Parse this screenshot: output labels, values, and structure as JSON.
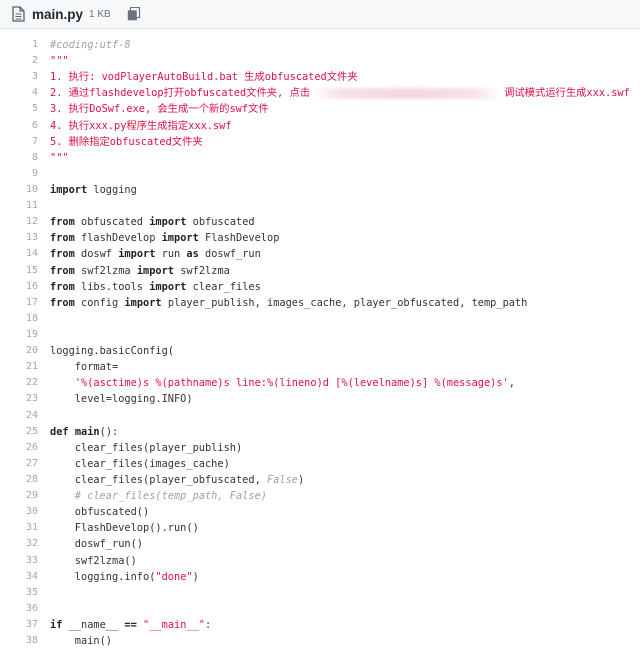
{
  "header": {
    "file_name": "main.py",
    "file_size": "1 KB"
  },
  "code": [
    {
      "n": "1",
      "parts": [
        {
          "t": "#coding:utf-8",
          "c": "comment"
        }
      ]
    },
    {
      "n": "2",
      "parts": [
        {
          "t": "\"\"\"",
          "c": "str"
        }
      ]
    },
    {
      "n": "3",
      "parts": [
        {
          "t": "1. 执行: vodPlayerAutoBuild.bat 生成obfuscated文件夹",
          "c": "str"
        }
      ]
    },
    {
      "n": "4",
      "parts": [
        {
          "t": "2. 通过flashdevelop打开obfuscated文件夹, 点击",
          "c": "str"
        },
        {
          "redacted": true
        },
        {
          "t": "调试模式运行生成xxx.swf",
          "c": "str"
        }
      ]
    },
    {
      "n": "5",
      "parts": [
        {
          "t": "3. 执行DoSwf.exe, 会生成一个新的swf文件",
          "c": "str"
        }
      ]
    },
    {
      "n": "6",
      "parts": [
        {
          "t": "4. 执行xxx.py程序生成指定xxx.swf",
          "c": "str"
        }
      ]
    },
    {
      "n": "7",
      "parts": [
        {
          "t": "5. 删除指定obfuscated文件夹",
          "c": "str"
        }
      ]
    },
    {
      "n": "8",
      "parts": [
        {
          "t": "\"\"\"",
          "c": "str"
        }
      ]
    },
    {
      "n": "9",
      "parts": []
    },
    {
      "n": "10",
      "parts": [
        {
          "t": "import",
          "c": "kw"
        },
        {
          "t": " logging",
          "c": "name"
        }
      ]
    },
    {
      "n": "11",
      "parts": []
    },
    {
      "n": "12",
      "parts": [
        {
          "t": "from",
          "c": "kw"
        },
        {
          "t": " obfuscated ",
          "c": "name"
        },
        {
          "t": "import",
          "c": "kw"
        },
        {
          "t": " obfuscated",
          "c": "name"
        }
      ]
    },
    {
      "n": "13",
      "parts": [
        {
          "t": "from",
          "c": "kw"
        },
        {
          "t": " flashDevelop ",
          "c": "name"
        },
        {
          "t": "import",
          "c": "kw"
        },
        {
          "t": " FlashDevelop",
          "c": "name"
        }
      ]
    },
    {
      "n": "14",
      "parts": [
        {
          "t": "from",
          "c": "kw"
        },
        {
          "t": " doswf ",
          "c": "name"
        },
        {
          "t": "import",
          "c": "kw"
        },
        {
          "t": " run ",
          "c": "name"
        },
        {
          "t": "as",
          "c": "kw"
        },
        {
          "t": " doswf_run",
          "c": "name"
        }
      ]
    },
    {
      "n": "15",
      "parts": [
        {
          "t": "from",
          "c": "kw"
        },
        {
          "t": " swf2lzma ",
          "c": "name"
        },
        {
          "t": "import",
          "c": "kw"
        },
        {
          "t": " swf2lzma",
          "c": "name"
        }
      ]
    },
    {
      "n": "16",
      "parts": [
        {
          "t": "from",
          "c": "kw"
        },
        {
          "t": " libs.tools ",
          "c": "name"
        },
        {
          "t": "import",
          "c": "kw"
        },
        {
          "t": " clear_files",
          "c": "name"
        }
      ]
    },
    {
      "n": "17",
      "parts": [
        {
          "t": "from",
          "c": "kw"
        },
        {
          "t": " config ",
          "c": "name"
        },
        {
          "t": "import",
          "c": "kw"
        },
        {
          "t": " player_publish, images_cache, player_obfuscated, temp_path",
          "c": "name"
        }
      ]
    },
    {
      "n": "18",
      "parts": []
    },
    {
      "n": "19",
      "parts": []
    },
    {
      "n": "20",
      "parts": [
        {
          "t": "logging.basicConfig(",
          "c": "name"
        }
      ]
    },
    {
      "n": "21",
      "parts": [
        {
          "t": "    format=",
          "c": "name"
        }
      ]
    },
    {
      "n": "22",
      "parts": [
        {
          "t": "    ",
          "c": "name"
        },
        {
          "t": "'%(asctime)s %(pathname)s line:%(lineno)d [%(levelname)s] %(message)s'",
          "c": "str"
        },
        {
          "t": ",",
          "c": "name"
        }
      ]
    },
    {
      "n": "23",
      "parts": [
        {
          "t": "    level=logging.INFO)",
          "c": "name"
        }
      ]
    },
    {
      "n": "24",
      "parts": []
    },
    {
      "n": "25",
      "parts": [
        {
          "t": "def",
          "c": "kw"
        },
        {
          "t": " ",
          "c": "name"
        },
        {
          "t": "main",
          "c": "kw"
        },
        {
          "t": "():",
          "c": "name"
        }
      ]
    },
    {
      "n": "26",
      "parts": [
        {
          "t": "    clear_files(player_publish)",
          "c": "name"
        }
      ]
    },
    {
      "n": "27",
      "parts": [
        {
          "t": "    clear_files(images_cache)",
          "c": "name"
        }
      ]
    },
    {
      "n": "28",
      "parts": [
        {
          "t": "    clear_files(player_obfuscated, ",
          "c": "name"
        },
        {
          "t": "False",
          "c": "comment"
        },
        {
          "t": ")",
          "c": "name"
        }
      ]
    },
    {
      "n": "29",
      "parts": [
        {
          "t": "    # clear_files(temp_path, False)",
          "c": "comment"
        }
      ]
    },
    {
      "n": "30",
      "parts": [
        {
          "t": "    obfuscated()",
          "c": "name"
        }
      ]
    },
    {
      "n": "31",
      "parts": [
        {
          "t": "    FlashDevelop().run()",
          "c": "name"
        }
      ]
    },
    {
      "n": "32",
      "parts": [
        {
          "t": "    doswf_run()",
          "c": "name"
        }
      ]
    },
    {
      "n": "33",
      "parts": [
        {
          "t": "    swf2lzma()",
          "c": "name"
        }
      ]
    },
    {
      "n": "34",
      "parts": [
        {
          "t": "    logging.info(",
          "c": "name"
        },
        {
          "t": "\"done\"",
          "c": "str"
        },
        {
          "t": ")",
          "c": "name"
        }
      ]
    },
    {
      "n": "35",
      "parts": []
    },
    {
      "n": "36",
      "parts": []
    },
    {
      "n": "37",
      "parts": [
        {
          "t": "if",
          "c": "kw"
        },
        {
          "t": " __name__ ",
          "c": "name"
        },
        {
          "t": "==",
          "c": "kw"
        },
        {
          "t": " ",
          "c": "name"
        },
        {
          "t": "\"__main__\"",
          "c": "str"
        },
        {
          "t": ":",
          "c": "name"
        }
      ]
    },
    {
      "n": "38",
      "parts": [
        {
          "t": "    main()",
          "c": "name"
        }
      ]
    }
  ]
}
